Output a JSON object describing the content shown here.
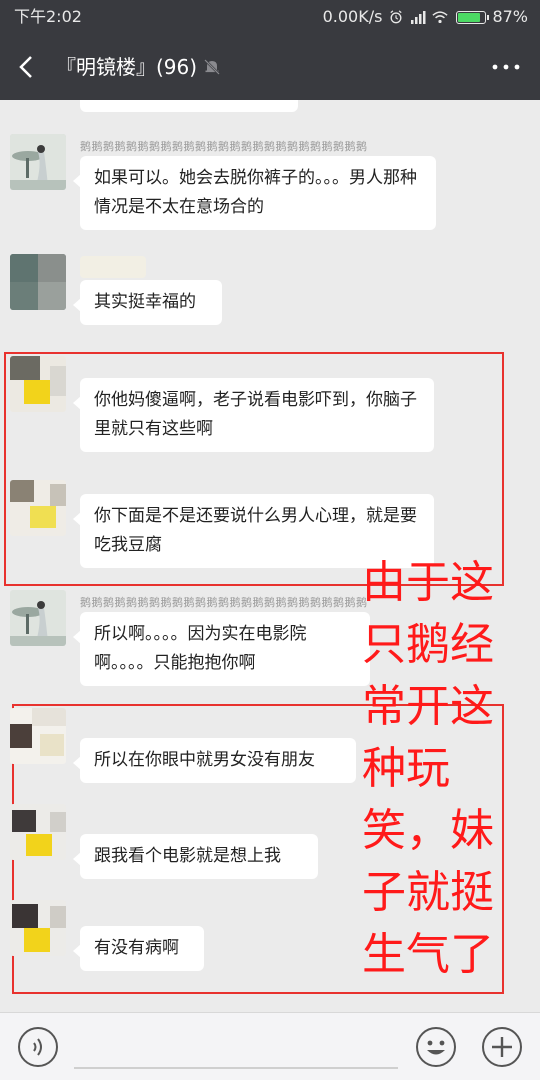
{
  "status_bar": {
    "time": "下午2:02",
    "speed": "0.00K/s",
    "battery": "87%",
    "battery_level": 0.87
  },
  "title_bar": {
    "title": "『明镜楼』(96)"
  },
  "messages": [
    {
      "nick": "鹅鹅鹅鹅鹅鹅鹅鹅鹅鹅鹅鹅鹅鹅鹅鹅鹅鹅鹅鹅鹅鹅鹅鹅鹅",
      "text": "如果可以。她会去脱你裤子的。。。男人那种情况是不太在意场合的"
    },
    {
      "nick": "",
      "text": "其实挺幸福的"
    },
    {
      "nick": "",
      "text": "你他妈傻逼啊，老子说看电影吓到，你脑子里就只有这些啊"
    },
    {
      "nick": "",
      "text": "你下面是不是还要说什么男人心理，就是要吃我豆腐"
    },
    {
      "nick": "鹅鹅鹅鹅鹅鹅鹅鹅鹅鹅鹅鹅鹅鹅鹅鹅鹅鹅鹅鹅鹅鹅鹅鹅鹅",
      "text": "所以啊。。。。因为实在电影院啊。。。。只能抱抱你啊"
    },
    {
      "nick": "",
      "text": "所以在你眼中就男女没有朋友"
    },
    {
      "nick": "",
      "text": "跟我看个电影就是想上我"
    },
    {
      "nick": "",
      "text": "有没有病啊"
    }
  ],
  "overlay": {
    "text": "由于这只鹅经常开这种玩笑，妹子就挺生气了",
    "color": "#ff1a1a"
  },
  "colors": {
    "header": "#393a3f",
    "chat_bg": "#ebebeb",
    "highlight_box": "#e8322e"
  }
}
